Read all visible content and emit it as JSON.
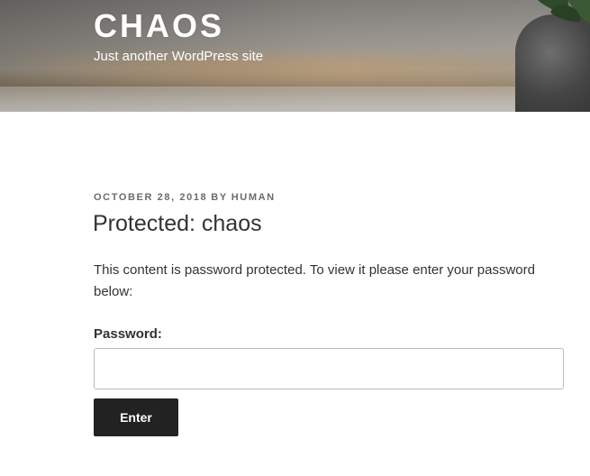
{
  "site": {
    "title": "CHAOS",
    "tagline": "Just another WordPress site"
  },
  "post": {
    "date": "OCTOBER 28, 2018",
    "by": "BY",
    "author": "HUMAN",
    "title": "Protected: chaos",
    "body": "This content is password protected. To view it please enter your password below:"
  },
  "password_form": {
    "label": "Password:",
    "value": "",
    "placeholder": "",
    "submit_label": "Enter"
  },
  "colors": {
    "button_bg": "#222222",
    "text": "#333333",
    "meta": "#6b6b6b"
  }
}
